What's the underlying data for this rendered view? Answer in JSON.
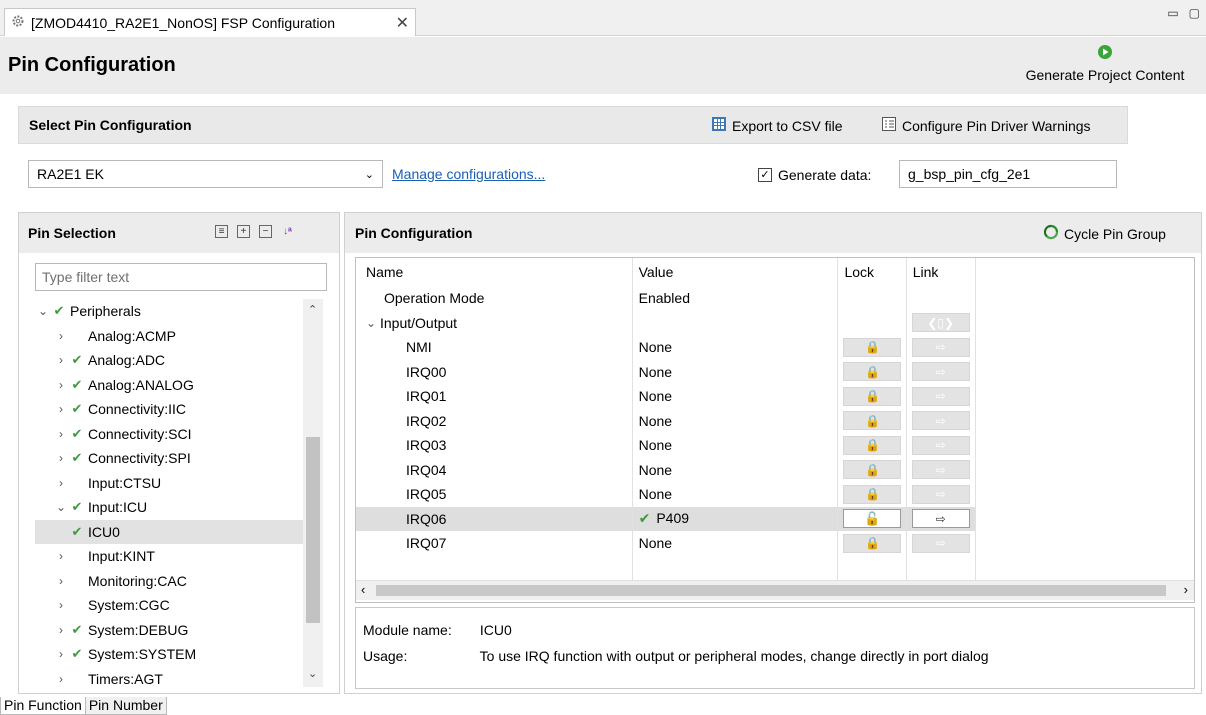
{
  "editor_tab": {
    "title": "[ZMOD4410_RA2E1_NonOS] FSP Configuration",
    "close": "✕"
  },
  "window_controls": {
    "minimize": "▭",
    "maximize": "▢"
  },
  "header": {
    "title": "Pin Configuration",
    "generate_label": "Generate Project Content"
  },
  "select_section": {
    "title": "Select Pin Configuration",
    "export_label": "Export to CSV file",
    "warnings_label": "Configure Pin Driver Warnings",
    "config_value": "RA2E1 EK",
    "manage_link": "Manage configurations...",
    "generate_data_label": "Generate data:",
    "generate_data_checked": "✓",
    "generate_data_value": "g_bsp_pin_cfg_2e1"
  },
  "pin_selection": {
    "title": "Pin Selection",
    "filter_placeholder": "Type filter text",
    "tree": [
      {
        "label": "Peripherals",
        "expander": "⌄",
        "check": "✔",
        "level": 0
      },
      {
        "label": "Analog:ACMP",
        "expander": "›",
        "check": "",
        "level": 1
      },
      {
        "label": "Analog:ADC",
        "expander": "›",
        "check": "✔",
        "level": 1
      },
      {
        "label": "Analog:ANALOG",
        "expander": "›",
        "check": "✔",
        "level": 1
      },
      {
        "label": "Connectivity:IIC",
        "expander": "›",
        "check": "✔",
        "level": 1
      },
      {
        "label": "Connectivity:SCI",
        "expander": "›",
        "check": "✔",
        "level": 1
      },
      {
        "label": "Connectivity:SPI",
        "expander": "›",
        "check": "✔",
        "level": 1
      },
      {
        "label": "Input:CTSU",
        "expander": "›",
        "check": "",
        "level": 1
      },
      {
        "label": "Input:ICU",
        "expander": "⌄",
        "check": "✔",
        "level": 1
      },
      {
        "label": "ICU0",
        "expander": "",
        "check": "✔",
        "level": 2,
        "selected": true
      },
      {
        "label": "Input:KINT",
        "expander": "›",
        "check": "",
        "level": 1
      },
      {
        "label": "Monitoring:CAC",
        "expander": "›",
        "check": "",
        "level": 1
      },
      {
        "label": "System:CGC",
        "expander": "›",
        "check": "",
        "level": 1
      },
      {
        "label": "System:DEBUG",
        "expander": "›",
        "check": "✔",
        "level": 1
      },
      {
        "label": "System:SYSTEM",
        "expander": "›",
        "check": "✔",
        "level": 1
      },
      {
        "label": "Timers:AGT",
        "expander": "›",
        "check": "",
        "level": 1
      }
    ]
  },
  "pin_config": {
    "title": "Pin Configuration",
    "cycle_label": "Cycle Pin Group",
    "columns": [
      "Name",
      "Value",
      "Lock",
      "Link"
    ],
    "rows": [
      {
        "name": "Operation Mode",
        "value": "Enabled",
        "indent": 1,
        "lock": "",
        "link": ""
      },
      {
        "name": "Input/Output",
        "value": "",
        "indent": 0,
        "expander": "⌄",
        "lock": "",
        "link": "❮▯❯"
      },
      {
        "name": "NMI",
        "value": "None",
        "indent": 2,
        "lock": "🔒",
        "link": "⇨"
      },
      {
        "name": "IRQ00",
        "value": "None",
        "indent": 2,
        "lock": "🔒",
        "link": "⇨"
      },
      {
        "name": "IRQ01",
        "value": "None",
        "indent": 2,
        "lock": "🔒",
        "link": "⇨"
      },
      {
        "name": "IRQ02",
        "value": "None",
        "indent": 2,
        "lock": "🔒",
        "link": "⇨"
      },
      {
        "name": "IRQ03",
        "value": "None",
        "indent": 2,
        "lock": "🔒",
        "link": "⇨"
      },
      {
        "name": "IRQ04",
        "value": "None",
        "indent": 2,
        "lock": "🔒",
        "link": "⇨"
      },
      {
        "name": "IRQ05",
        "value": "None",
        "indent": 2,
        "lock": "🔒",
        "link": "⇨"
      },
      {
        "name": "IRQ06",
        "value": "P409",
        "value_check": "✔",
        "indent": 2,
        "lock": "🔓",
        "link": "⇨",
        "selected": true,
        "active": true
      },
      {
        "name": "IRQ07",
        "value": "None",
        "indent": 2,
        "lock": "🔒",
        "link": "⇨"
      }
    ]
  },
  "info": {
    "module_label": "Module name:",
    "module_value": "ICU0",
    "usage_label": "Usage:",
    "usage_value": "To use IRQ function with output or peripheral modes, change directly in port dialog"
  },
  "bottom_tabs": [
    "Pin Function",
    "Pin Number"
  ],
  "colors": {
    "check_green": "#3c9a3c",
    "link_blue": "#1a5fb4",
    "lock_gold": "#d49b1a",
    "generate_green": "#3aa53a"
  }
}
